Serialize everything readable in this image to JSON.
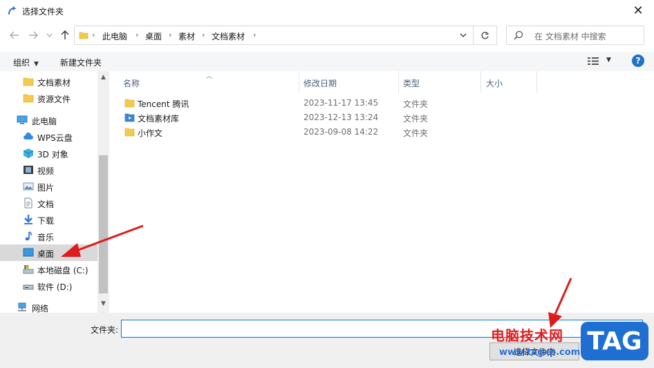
{
  "window": {
    "title": "选择文件夹",
    "close_glyph": "✕"
  },
  "address": {
    "breadcrumbs": [
      "此电脑",
      "桌面",
      "素材",
      "文档素材"
    ],
    "search_placeholder": "在 文档素材 中搜索"
  },
  "toolbar": {
    "organize_label": "组织",
    "new_folder_label": "新建文件夹",
    "help_glyph": "?"
  },
  "nav_pane": {
    "items": [
      {
        "label": "文档素材",
        "icon": "folder-icon"
      },
      {
        "label": "资源文件",
        "icon": "folder-icon"
      },
      {
        "label": "此电脑",
        "icon": "computer-icon"
      },
      {
        "label": "WPS云盘",
        "icon": "cloud-icon"
      },
      {
        "label": "3D 对象",
        "icon": "cube-icon"
      },
      {
        "label": "视频",
        "icon": "video-icon"
      },
      {
        "label": "图片",
        "icon": "picture-icon"
      },
      {
        "label": "文档",
        "icon": "document-icon"
      },
      {
        "label": "下载",
        "icon": "download-icon"
      },
      {
        "label": "音乐",
        "icon": "music-icon"
      },
      {
        "label": "桌面",
        "icon": "desktop-icon",
        "selected": true
      },
      {
        "label": "本地磁盘 (C:)",
        "icon": "drive-c-icon"
      },
      {
        "label": "软件 (D:)",
        "icon": "drive-d-icon"
      },
      {
        "label": "网络",
        "icon": "network-icon"
      }
    ]
  },
  "file_list": {
    "columns": [
      "名称",
      "修改日期",
      "类型",
      "大小"
    ],
    "rows": [
      {
        "name": "Tencent 腾讯",
        "date": "2023-11-17 13:45",
        "type": "文件夹",
        "icon": "folder-icon"
      },
      {
        "name": "文档素材库",
        "date": "2023-12-13 13:24",
        "type": "文件夹",
        "icon": "library-folder-icon"
      },
      {
        "name": "小作文",
        "date": "2023-09-08 14:22",
        "type": "文件夹",
        "icon": "folder-icon"
      }
    ]
  },
  "bottom": {
    "folder_label": "文件夹:",
    "folder_value": "",
    "select_button": "选择文件夹"
  },
  "watermark": {
    "site_name": "电脑技术网",
    "url": "www.tagxp.com",
    "badge": "TAG"
  },
  "colors": {
    "accent": "#0078d7",
    "selection": "#d9d9d9",
    "folder": "#f3c94e",
    "annotation_arrow": "#e01b1b"
  }
}
